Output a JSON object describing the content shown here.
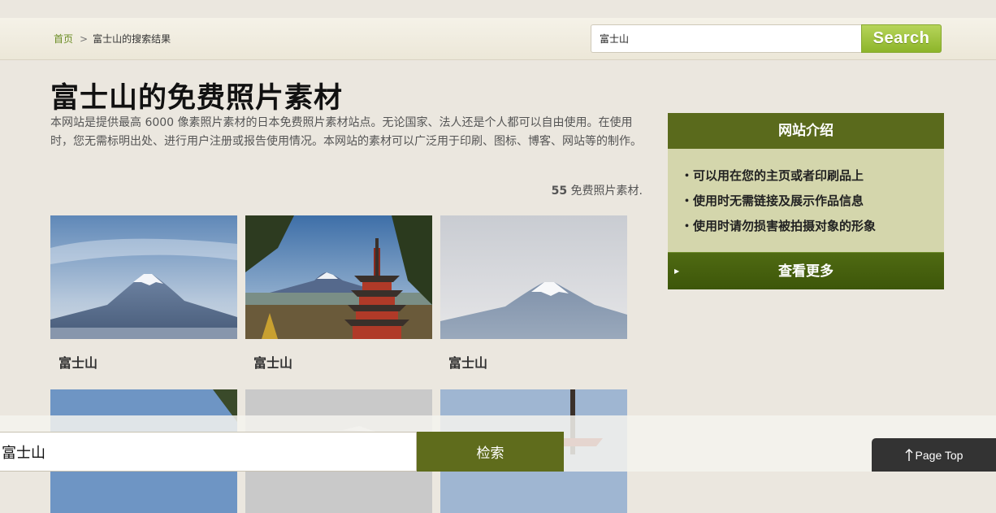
{
  "header": {
    "breadcrumb": {
      "home": "首页",
      "separator": ">",
      "current": "富士山的搜索结果"
    },
    "search": {
      "value": "富士山",
      "button_label": "Search"
    }
  },
  "main": {
    "title": "富士山的免费照片素材",
    "intro": "本网站是提供最高 6000 像素照片素材的日本免费照片素材站点。无论国家、法人还是个人都可以自由使用。在使用时，您无需标明出处、进行用户注册或报告使用情况。本网站的素材可以广泛用于印刷、图标、博客、网站等的制作。",
    "count_number": "55",
    "count_label": " 免费照片素材."
  },
  "photos": [
    {
      "caption": "富士山"
    },
    {
      "caption": "富士山"
    },
    {
      "caption": "富士山"
    },
    {
      "caption": ""
    },
    {
      "caption": ""
    },
    {
      "caption": ""
    }
  ],
  "sidebar": {
    "title": "网站介绍",
    "items": [
      "可以用在您的主页或者印刷品上",
      "使用时无需链接及展示作品信息",
      "使用时请勿损害被拍摄对象的形象"
    ],
    "more_label": "查看更多"
  },
  "footer": {
    "search_value": "富士山",
    "search_button": "检索",
    "pagetop_label": "Page Top"
  },
  "colors": {
    "accent_green": "#8db52a",
    "sidebar_head": "#5a6a1c",
    "sidebar_body": "#d4d6ac"
  }
}
